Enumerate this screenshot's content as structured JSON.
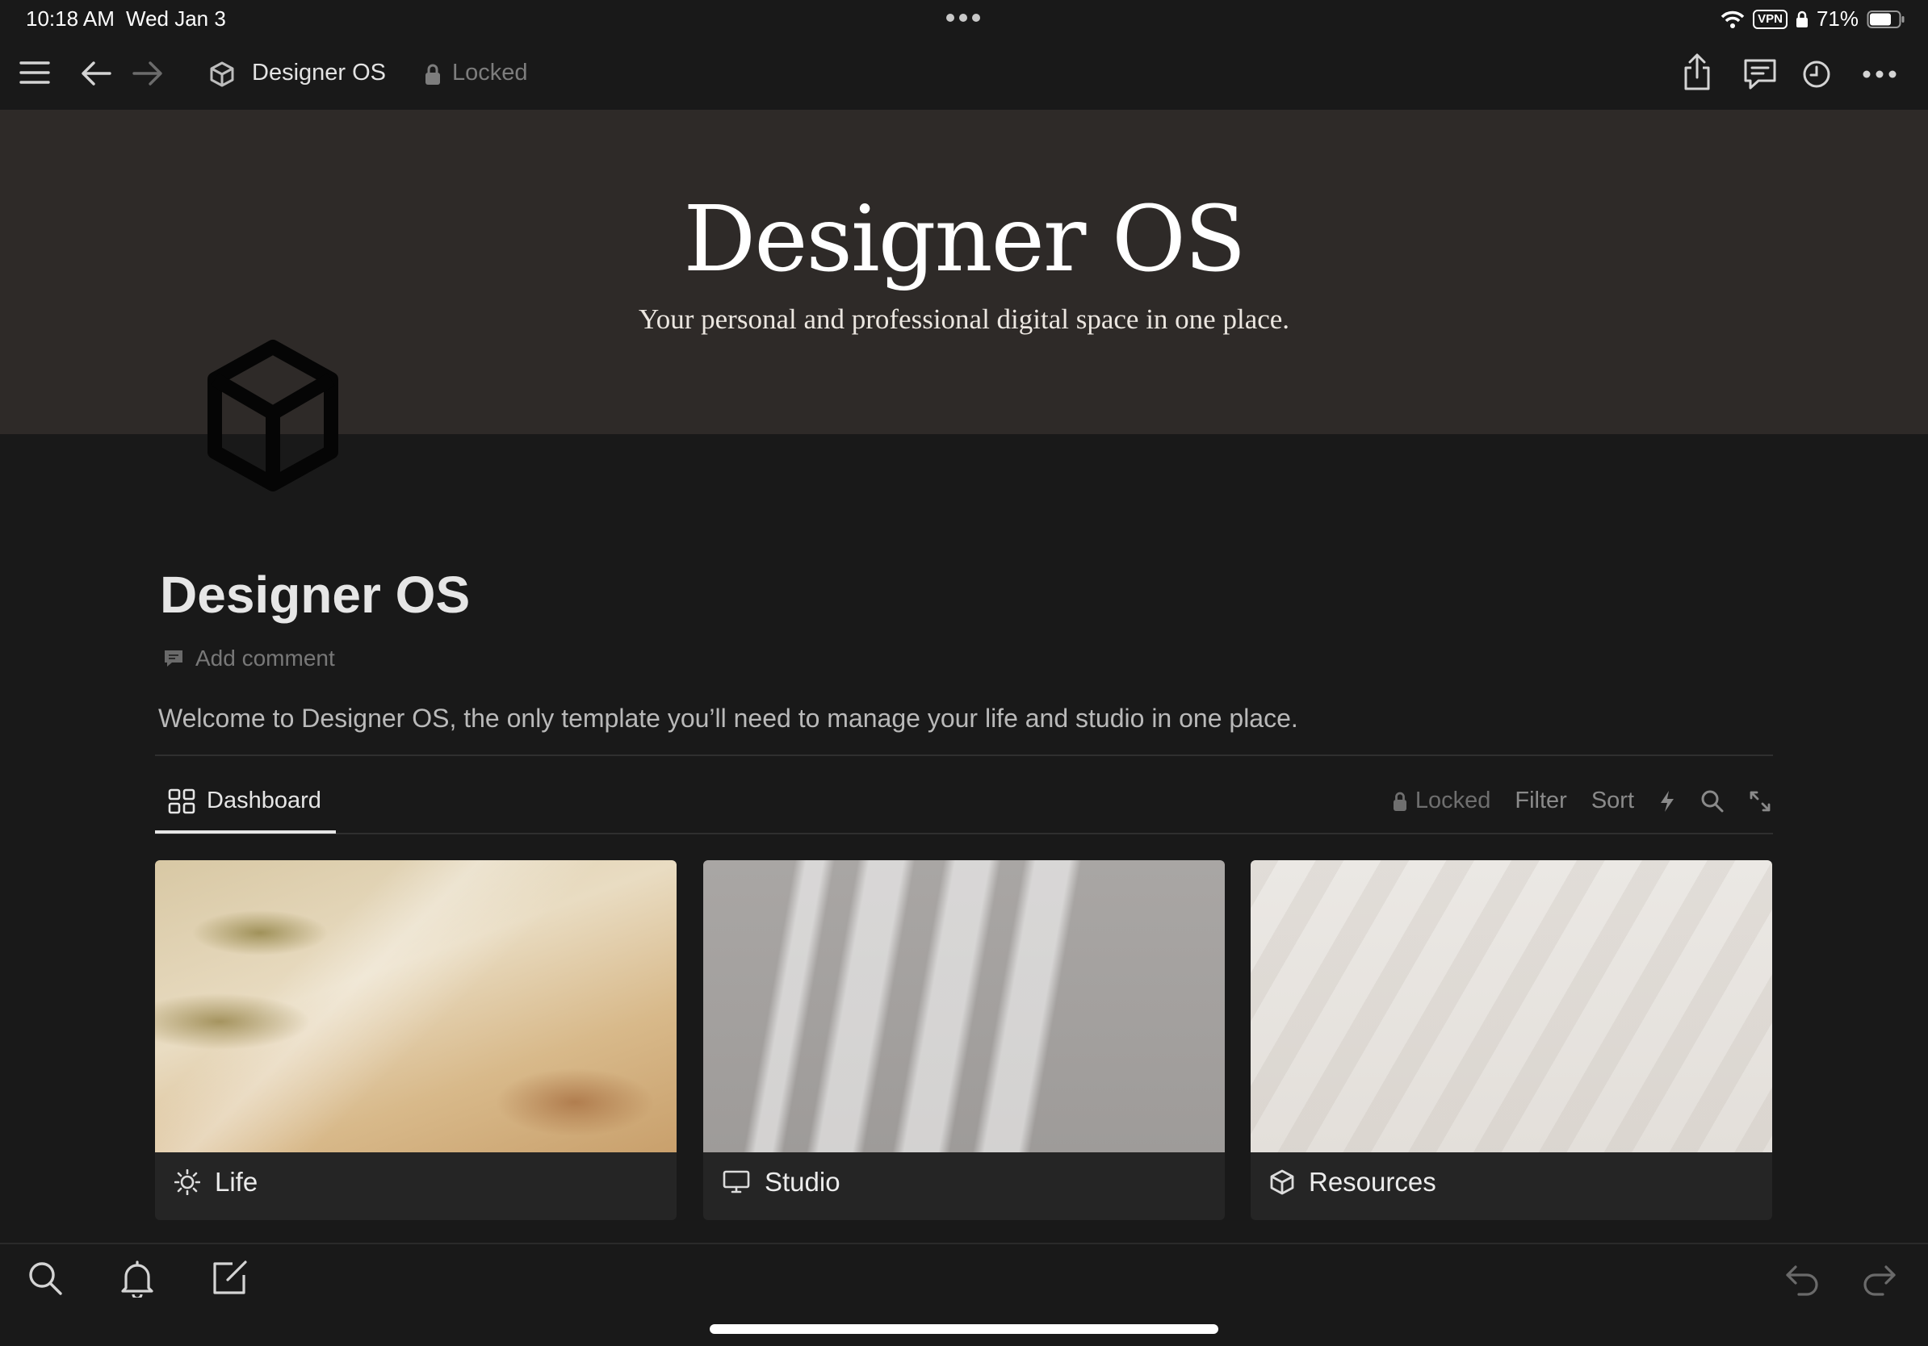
{
  "status_bar": {
    "time": "10:18 AM",
    "date": "Wed Jan 3",
    "vpn": "VPN",
    "battery": "71%",
    "icons": [
      "wifi-icon",
      "vpn-icon",
      "lock-icon",
      "battery-icon"
    ]
  },
  "toolbar": {
    "breadcrumb_title": "Designer OS",
    "locked_label": "Locked",
    "left_icons": [
      "menu-icon",
      "back-arrow-icon",
      "forward-arrow-icon",
      "cube-icon"
    ],
    "right_icons": [
      "share-icon",
      "comments-icon",
      "history-clock-icon",
      "more-icon"
    ]
  },
  "cover": {
    "title": "Designer OS",
    "subtitle": "Your personal and professional digital space in one place."
  },
  "page": {
    "title": "Designer OS",
    "add_comment": "Add comment",
    "welcome": "Welcome to Designer OS, the only template you’ll need to manage your life and studio in one place."
  },
  "view": {
    "tab_label": "Dashboard",
    "locked": "Locked",
    "filter": "Filter",
    "sort": "Sort"
  },
  "cards": [
    {
      "label": "Life",
      "icon": "sun-icon"
    },
    {
      "label": "Studio",
      "icon": "monitor-icon"
    },
    {
      "label": "Resources",
      "icon": "cube-icon"
    }
  ],
  "bottom_bar": {
    "left_icons": [
      "search-icon",
      "bell-icon",
      "compose-icon"
    ],
    "right_icons": [
      "undo-icon",
      "redo-icon"
    ]
  },
  "colors": {
    "background": "#191919",
    "cover_background": "#2e2a28",
    "card_background": "#252525"
  }
}
